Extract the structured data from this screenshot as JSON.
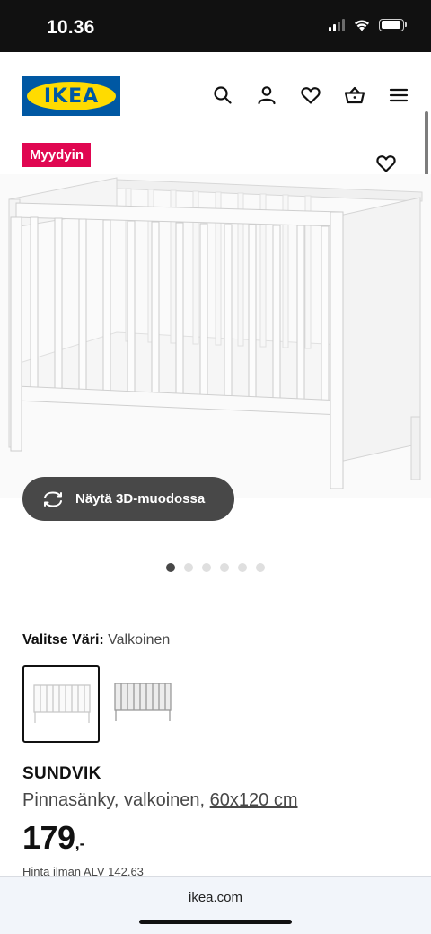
{
  "status": {
    "time": "10.36"
  },
  "header": {
    "logo_text": "IKEA",
    "brand_colors": {
      "blue": "#0058a3",
      "yellow": "#ffdb00"
    },
    "icons": [
      "search-icon",
      "user-icon",
      "heart-icon",
      "basket-icon",
      "menu-icon"
    ]
  },
  "gallery": {
    "badge": "Myydyin",
    "badge_color": "#e00751",
    "view_3d_label": "Näytä 3D-muodossa",
    "image_count": 6,
    "active_index": 0
  },
  "color": {
    "label": "Valitse Väri:",
    "value": "Valkoinen",
    "swatches": [
      "white-crib",
      "grey-crib"
    ],
    "selected_index": 0
  },
  "product": {
    "name": "SUNDVIK",
    "description": "Pinnasänky, valkoinen,",
    "size": "60x120 cm",
    "price_int": "179",
    "price_dec": ",-",
    "vat_text": "Hinta ilman ALV 142,63"
  },
  "browser": {
    "url": "ikea.com"
  }
}
